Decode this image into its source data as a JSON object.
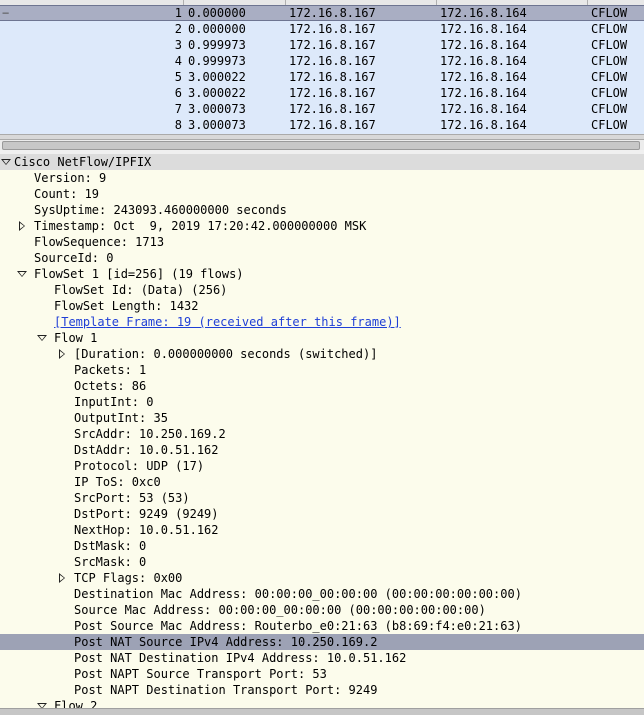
{
  "packet_list": {
    "rows": [
      {
        "no": "1",
        "time": "0.000000",
        "src": "172.16.8.167",
        "dst": "172.16.8.164",
        "proto": "CFLOW",
        "selected": true
      },
      {
        "no": "2",
        "time": "0.000000",
        "src": "172.16.8.167",
        "dst": "172.16.8.164",
        "proto": "CFLOW"
      },
      {
        "no": "3",
        "time": "0.999973",
        "src": "172.16.8.167",
        "dst": "172.16.8.164",
        "proto": "CFLOW"
      },
      {
        "no": "4",
        "time": "0.999973",
        "src": "172.16.8.167",
        "dst": "172.16.8.164",
        "proto": "CFLOW"
      },
      {
        "no": "5",
        "time": "3.000022",
        "src": "172.16.8.167",
        "dst": "172.16.8.164",
        "proto": "CFLOW"
      },
      {
        "no": "6",
        "time": "3.000022",
        "src": "172.16.8.167",
        "dst": "172.16.8.164",
        "proto": "CFLOW"
      },
      {
        "no": "7",
        "time": "3.000073",
        "src": "172.16.8.167",
        "dst": "172.16.8.164",
        "proto": "CFLOW"
      },
      {
        "no": "8",
        "time": "3.000073",
        "src": "172.16.8.167",
        "dst": "172.16.8.164",
        "proto": "CFLOW"
      }
    ]
  },
  "detail": {
    "root": "Cisco NetFlow/IPFIX",
    "version": "Version: 9",
    "count": "Count: 19",
    "sysuptime": "SysUptime: 243093.460000000 seconds",
    "timestamp": "Timestamp: Oct  9, 2019 17:20:42.000000000 MSK",
    "flowsequence": "FlowSequence: 1713",
    "sourceid": "SourceId: 0",
    "flowset": "FlowSet 1 [id=256] (19 flows)",
    "flowset_id": "FlowSet Id: (Data) (256)",
    "flowset_length": "FlowSet Length: 1432",
    "template_frame": "[Template Frame: 19 (received after this frame)]",
    "flow1": "Flow 1",
    "duration": "[Duration: 0.000000000 seconds (switched)]",
    "packets": "Packets: 1",
    "octets": "Octets: 86",
    "inputint": "InputInt: 0",
    "outputint": "OutputInt: 35",
    "srcaddr": "SrcAddr: 10.250.169.2",
    "dstaddr": "DstAddr: 10.0.51.162",
    "protocol": "Protocol: UDP (17)",
    "iptos": "IP ToS: 0xc0",
    "srcport": "SrcPort: 53 (53)",
    "dstport": "DstPort: 9249 (9249)",
    "nexthop": "NextHop: 10.0.51.162",
    "dstmask": "DstMask: 0",
    "srcmask": "SrcMask: 0",
    "tcpflags": "TCP Flags: 0x00",
    "dst_mac": "Destination Mac Address: 00:00:00_00:00:00 (00:00:00:00:00:00)",
    "src_mac": "Source Mac Address: 00:00:00_00:00:00 (00:00:00:00:00:00)",
    "post_src_mac": "Post Source Mac Address: Routerbo_e0:21:63 (b8:69:f4:e0:21:63)",
    "post_nat_src": "Post NAT Source IPv4 Address: 10.250.169.2",
    "post_nat_dst": "Post NAT Destination IPv4 Address: 10.0.51.162",
    "post_napt_src": "Post NAPT Source Transport Port: 53",
    "post_napt_dst": "Post NAPT Destination Transport Port: 9249",
    "flow2": "Flow 2"
  }
}
